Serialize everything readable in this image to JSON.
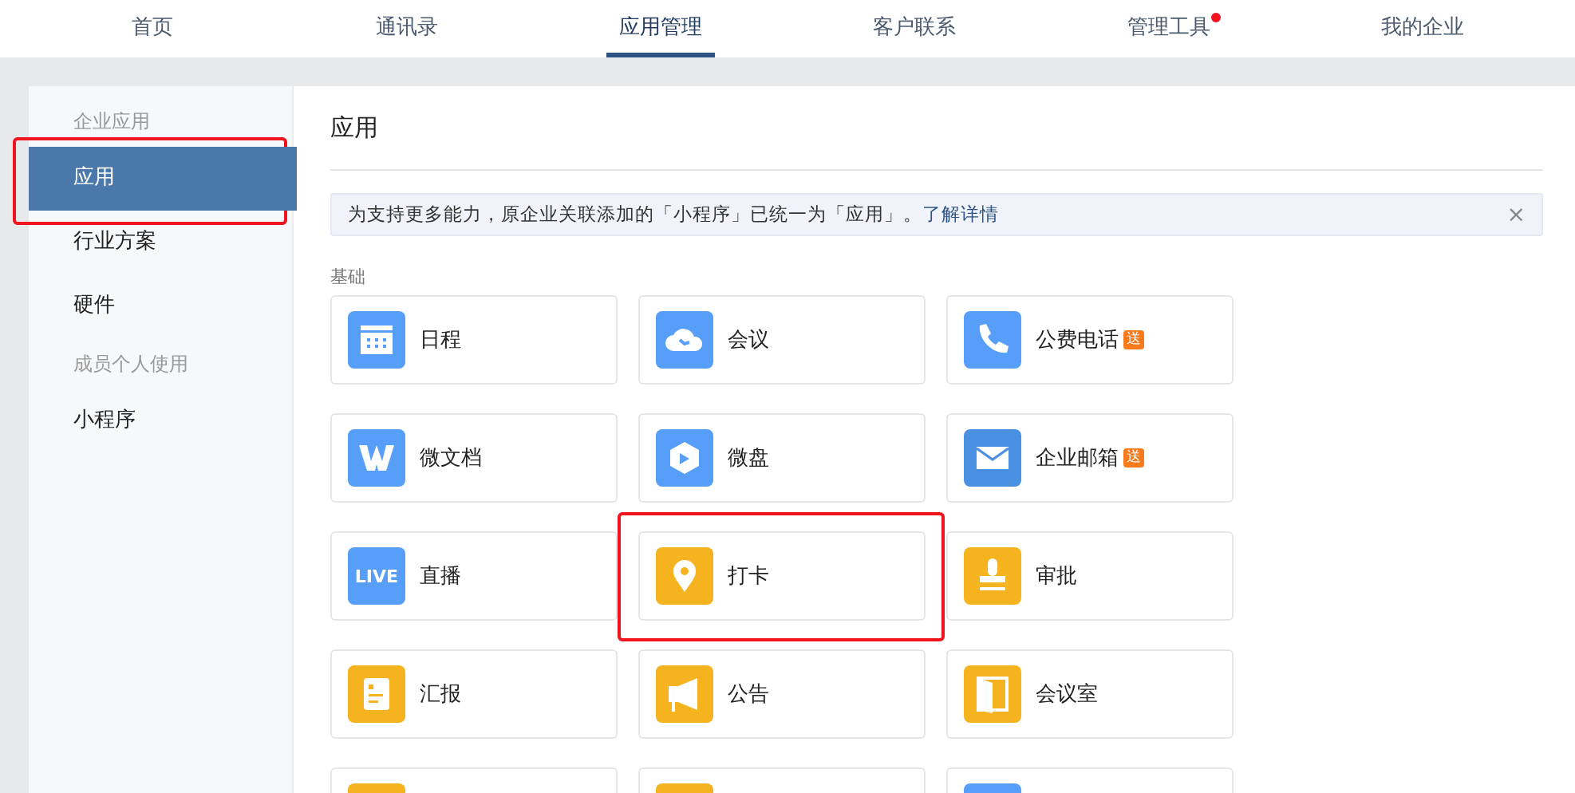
{
  "nav": {
    "tabs": [
      {
        "label": "首页",
        "selected": false,
        "dot": false
      },
      {
        "label": "通讯录",
        "selected": false,
        "dot": false
      },
      {
        "label": "应用管理",
        "selected": true,
        "dot": false
      },
      {
        "label": "客户联系",
        "selected": false,
        "dot": false
      },
      {
        "label": "管理工具",
        "selected": false,
        "dot": true
      },
      {
        "label": "我的企业",
        "selected": false,
        "dot": false
      }
    ]
  },
  "sidebar": {
    "groups": [
      {
        "label": "企业应用",
        "items": [
          {
            "label": "应用",
            "selected": true,
            "highlighted": true
          },
          {
            "label": "行业方案",
            "selected": false,
            "highlighted": false
          },
          {
            "label": "硬件",
            "selected": false,
            "highlighted": false
          }
        ]
      },
      {
        "label": "成员个人使用",
        "items": [
          {
            "label": "小程序",
            "selected": false,
            "highlighted": false
          }
        ]
      }
    ]
  },
  "content": {
    "title": "应用",
    "notice": {
      "text": "为支持更多能力，原企业关联添加的「小程序」已统一为「应用」。",
      "link": "了解详情",
      "close": "×"
    },
    "section": "基础",
    "apps": [
      {
        "kind": "calendar",
        "name": "日程",
        "color": "#579ef8",
        "highlighted": false
      },
      {
        "kind": "cloud",
        "name": "会议",
        "color": "#579ef8",
        "highlighted": false
      },
      {
        "kind": "phone",
        "name": "公费电话",
        "color": "#579ef8",
        "badge": "送",
        "highlighted": false
      },
      {
        "kind": "doc",
        "name": "微文档",
        "color": "#579ef8",
        "highlighted": false
      },
      {
        "kind": "disk",
        "name": "微盘",
        "color": "#579ef8",
        "highlighted": false
      },
      {
        "kind": "mail",
        "name": "企业邮箱",
        "color": "#4a90e2",
        "badge": "送",
        "highlighted": false
      },
      {
        "kind": "live",
        "icon_text": "LIVE",
        "name": "直播",
        "color": "#579ef8",
        "highlighted": false
      },
      {
        "kind": "pin",
        "name": "打卡",
        "color": "#f5b31f",
        "highlighted": true
      },
      {
        "kind": "stamp",
        "name": "审批",
        "color": "#f5b31f",
        "highlighted": false
      },
      {
        "kind": "report",
        "name": "汇报",
        "color": "#f5b31f",
        "highlighted": false
      },
      {
        "kind": "horn",
        "name": "公告",
        "color": "#f5b31f",
        "highlighted": false
      },
      {
        "kind": "door",
        "name": "会议室",
        "color": "#f5b31f",
        "highlighted": false
      },
      {
        "kind": "blank",
        "color": "#f5b31f",
        "highlighted": false
      },
      {
        "kind": "blank",
        "color": "#f5b31f",
        "highlighted": false
      },
      {
        "kind": "blank",
        "color": "#579ef8",
        "highlighted": false
      }
    ]
  }
}
